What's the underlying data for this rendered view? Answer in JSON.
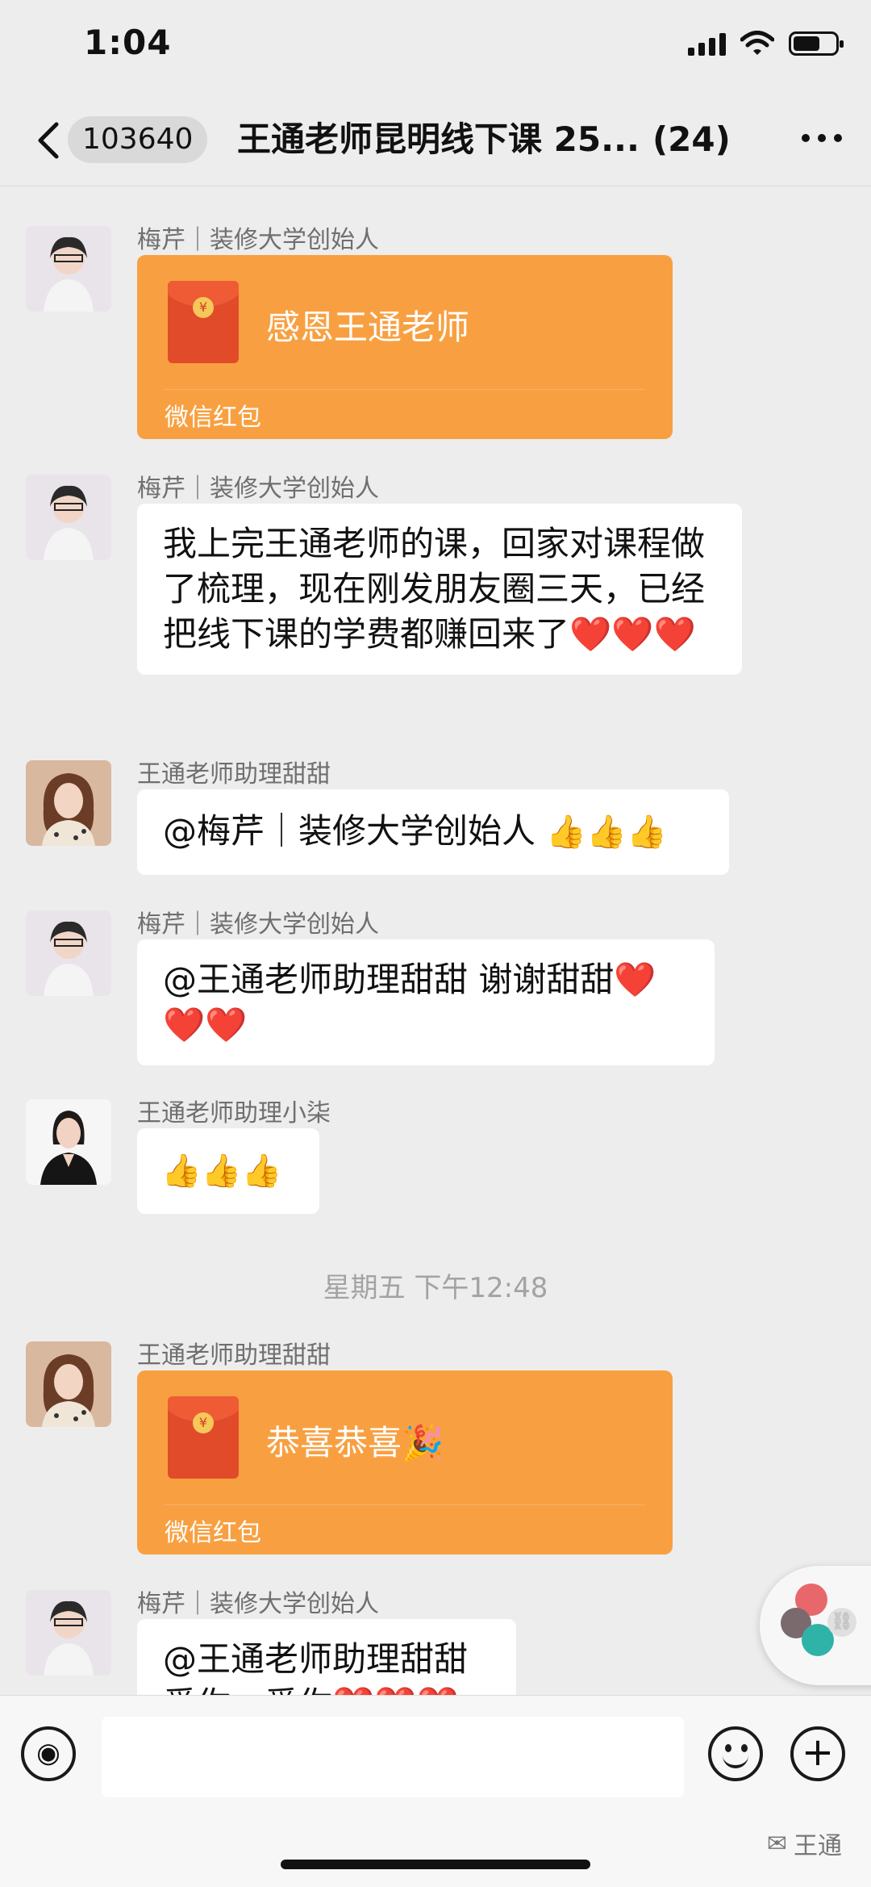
{
  "status": {
    "time": "1:04"
  },
  "header": {
    "unread_badge": "103640",
    "title": "王通老师昆明线下课 25...",
    "member_count": "(24)"
  },
  "messages": [
    {
      "sender": "梅芹｜装修大学创始人",
      "type": "red_packet",
      "text": "感恩王通老师",
      "footer": "微信红包"
    },
    {
      "sender": "梅芹｜装修大学创始人",
      "type": "text",
      "text": "我上完王通老师的课，回家对课程做了梳理，现在刚发朋友圈三天，已经把线下课的学费都赚回来了",
      "emoji": "❤️❤️❤️"
    },
    {
      "sender": "王通老师助理甜甜",
      "type": "text",
      "text": "@梅芹｜装修大学创始人 ",
      "emoji": "👍👍👍"
    },
    {
      "sender": "梅芹｜装修大学创始人",
      "type": "text",
      "text": "@王通老师助理甜甜 谢谢甜甜",
      "emoji": "❤️❤️❤️"
    },
    {
      "sender": "王通老师助理小柒",
      "type": "text",
      "text": "",
      "emoji": "👍👍👍"
    },
    {
      "sender": "王通老师助理甜甜",
      "type": "red_packet",
      "text": "恭喜恭喜🎉",
      "footer": "微信红包"
    },
    {
      "sender": "梅芹｜装修大学创始人",
      "type": "text",
      "text": "@王通老师助理甜甜",
      "text_line2": "爱你，爱你",
      "emoji": "❤️❤️❤️"
    }
  ],
  "timestamp": "星期五 下午12:48",
  "watermark": "王通",
  "colors": {
    "red_packet": "#f8a041",
    "heart": "#f05a28",
    "background": "#ededed"
  }
}
